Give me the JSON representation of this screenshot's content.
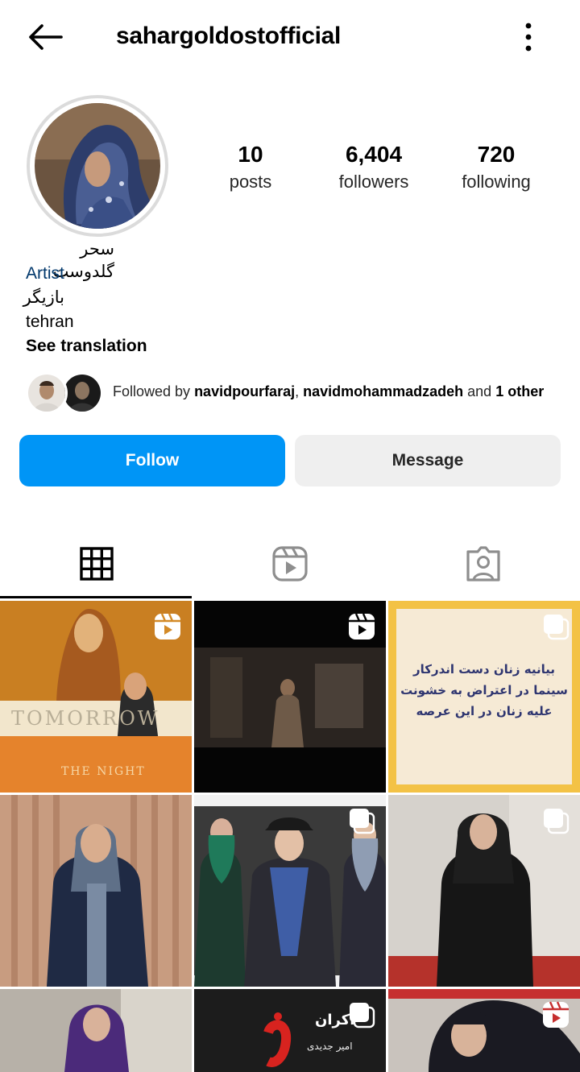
{
  "header": {
    "username": "sahargoldostofficial",
    "back_icon": "arrow-left-icon",
    "menu_icon": "more-vertical-icon"
  },
  "profile": {
    "stats": [
      {
        "value": "10",
        "label": "posts"
      },
      {
        "value": "6,404",
        "label": "followers"
      },
      {
        "value": "720",
        "label": "following"
      }
    ],
    "display_name": "سحر گلدوست",
    "category": "Artist",
    "bio_line": "بازیگر",
    "location": "tehran",
    "see_translation": "See translation"
  },
  "followed_by": {
    "prefix": "Followed by ",
    "user1": "navidpourfaraj",
    "separator": ", ",
    "user2": "navidmohammadzadeh",
    "and": " and ",
    "others": "1 other"
  },
  "actions": {
    "follow": "Follow",
    "message": "Message"
  },
  "tabs": [
    {
      "icon": "grid-icon",
      "active": true
    },
    {
      "icon": "reels-icon",
      "active": false
    },
    {
      "icon": "tagged-icon",
      "active": false
    }
  ],
  "posts": {
    "post1": {
      "title": "TOMORROW",
      "subtitle": "THE NIGHT",
      "badge": "reels-icon"
    },
    "post2": {
      "badge": "reels-icon"
    },
    "post3": {
      "line1": "بیانیه زنان دست اندرکار",
      "line2": "سینما در اعتراض به خشونت",
      "line3": "علیه زنان در این عرصه",
      "badge": "carousel-icon"
    },
    "post4": {
      "badge": ""
    },
    "post5": {
      "badge": "carousel-icon"
    },
    "post6": {
      "badge": "carousel-icon"
    },
    "post8": {
      "title": "اکران",
      "name": "امیر جدیدی",
      "badge": "carousel-icon"
    },
    "post9": {
      "badge": "reels-icon"
    }
  },
  "colors": {
    "follow_blue": "#0095f6",
    "category_blue": "#00376b",
    "message_gray": "#efefef"
  }
}
